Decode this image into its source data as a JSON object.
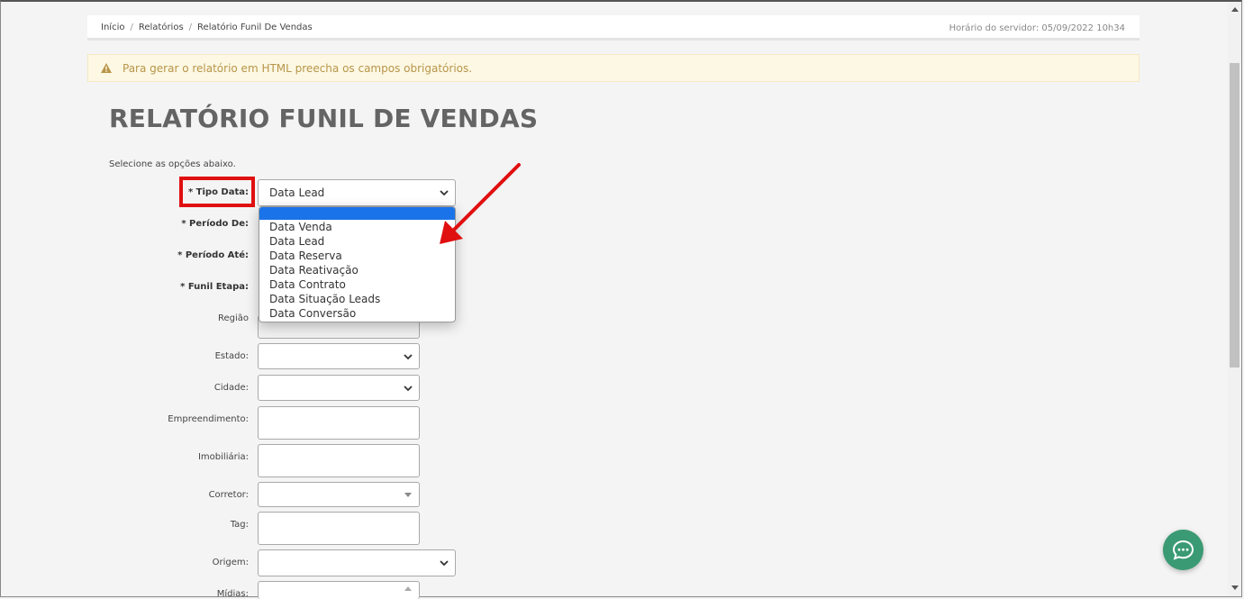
{
  "breadcrumb": {
    "items": [
      "Início",
      "Relatórios",
      "Relatório Funil De Vendas"
    ],
    "separator": "/"
  },
  "server_time": "Horário do servidor: 05/09/2022 10h34",
  "alert": {
    "message": "Para gerar o relatório em HTML preecha os campos obrigatórios.",
    "icon": "warning-icon"
  },
  "page_title": "RELATÓRIO FUNIL DE VENDAS",
  "subtitle": "Selecione as opções abaixo.",
  "form": {
    "tipo_data_label": "* Tipo Data:",
    "tipo_data_value": "Data Lead",
    "periodo_de_label": "* Período De:",
    "periodo_ate_label": "* Período Até:",
    "funil_etapa_label": "* Funil Etapa:",
    "regiao_label": "Região",
    "estado_label": "Estado:",
    "cidade_label": "Cidade:",
    "empreendimento_label": "Empreendimento:",
    "imobiliaria_label": "Imobiliária:",
    "corretor_label": "Corretor:",
    "tag_label": "Tag:",
    "origem_label": "Origem:",
    "midias_label": "Mídias:"
  },
  "dropdown": {
    "options": [
      "",
      "Data Venda",
      "Data Lead",
      "Data Reserva",
      "Data Reativação",
      "Data Contrato",
      "Data Situação Leads",
      "Data Conversão"
    ]
  },
  "colors": {
    "highlight": "#e01010",
    "selected_option": "#1a73e8",
    "chat_button": "#3a9a73",
    "alert_text": "#b8954a"
  }
}
